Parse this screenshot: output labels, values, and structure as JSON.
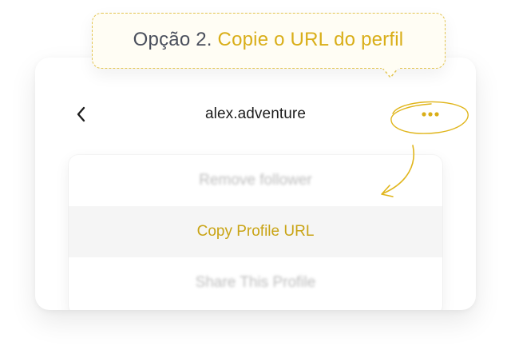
{
  "callout": {
    "prefix": "Opção 2.",
    "highlight": "Copie o URL do perfil"
  },
  "header": {
    "title": "alex.adventure",
    "back_icon": "chevron-left-icon",
    "more_icon": "more-horizontal-icon"
  },
  "menu": {
    "items": [
      {
        "label": "Remove follower",
        "state": "blurred"
      },
      {
        "label": "Copy Profile URL",
        "state": "highlighted"
      },
      {
        "label": "Share This Profile",
        "state": "blurred"
      }
    ]
  },
  "colors": {
    "accent": "#d9ae18",
    "menu_highlight_text": "#c9a415",
    "title_text": "#1d1d1d",
    "muted_text": "#bdbdbd",
    "callout_prefix": "#4a4f5c",
    "callout_border": "#e3c552"
  }
}
